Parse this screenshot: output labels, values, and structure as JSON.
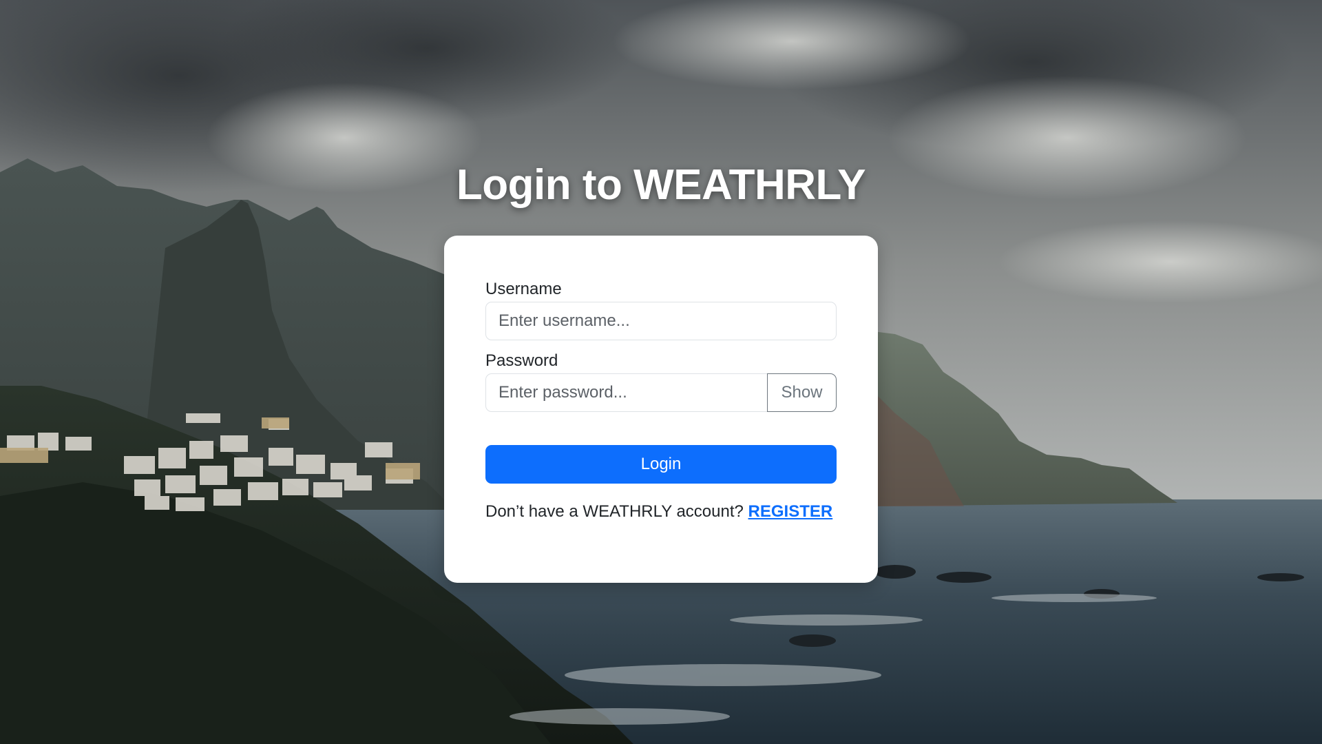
{
  "page": {
    "title": "Login to WEATHRLY"
  },
  "form": {
    "username_label": "Username",
    "username_placeholder": "Enter username...",
    "username_value": "",
    "password_label": "Password",
    "password_placeholder": "Enter password...",
    "password_value": "",
    "show_label": "Show",
    "login_label": "Login",
    "register_prompt": "Don’t have a WEATHRLY account?",
    "register_link": "REGISTER"
  },
  "colors": {
    "primary": "#0d6efd",
    "card": "#ffffff",
    "title": "#ffffff",
    "text": "#212529",
    "secondary": "#6c757d"
  }
}
